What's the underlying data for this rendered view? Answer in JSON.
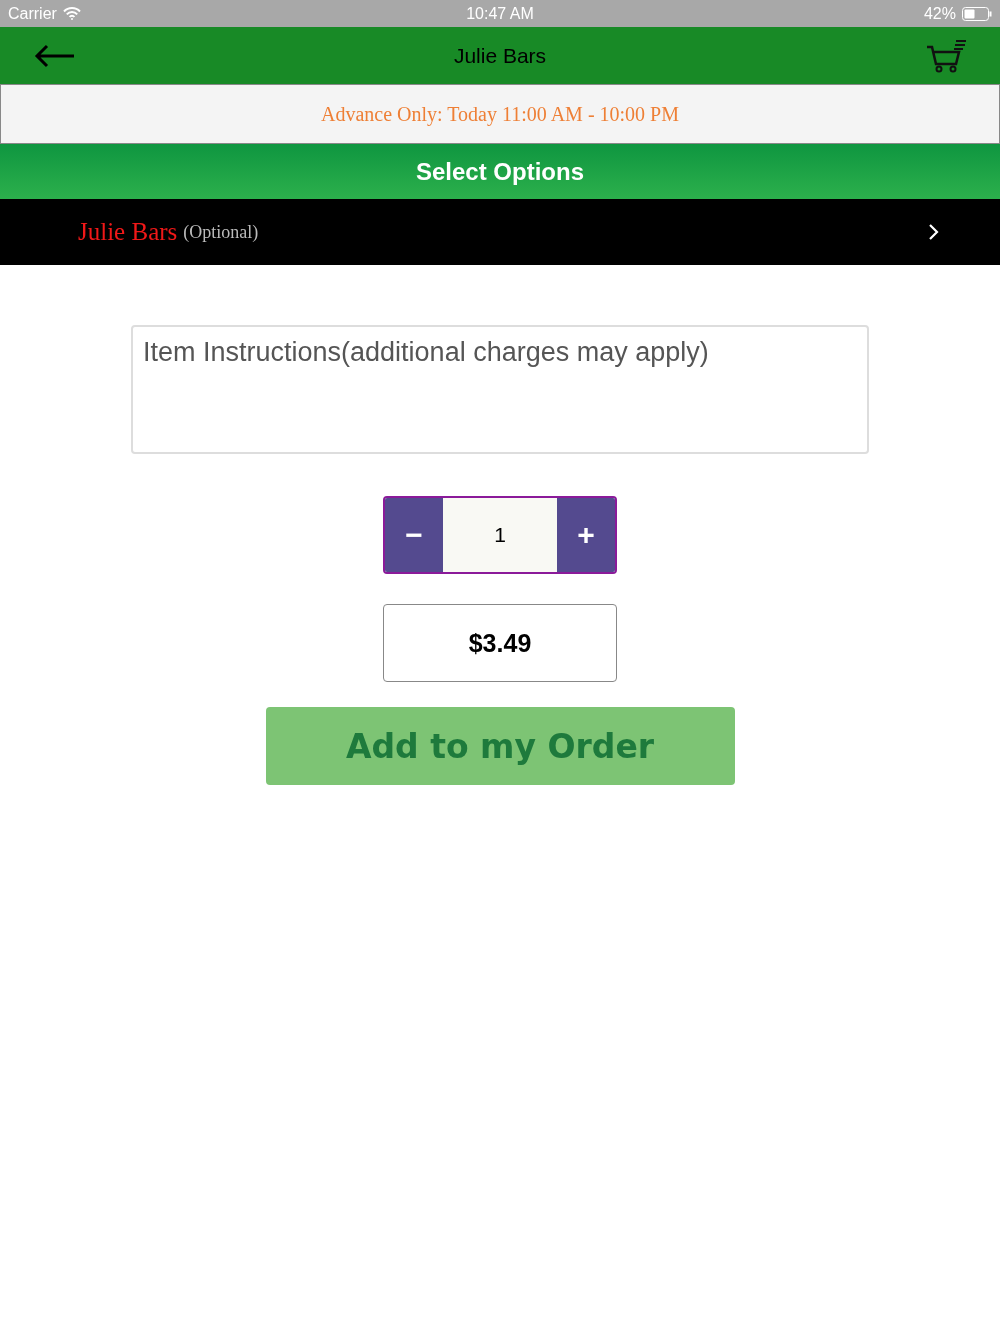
{
  "status_bar": {
    "carrier": "Carrier",
    "time": "10:47 AM",
    "battery": "42%"
  },
  "nav_bar": {
    "title": "Julie Bars"
  },
  "notice": "Advance Only: Today 11:00 AM - 10:00 PM",
  "section_header": "Select Options",
  "option_row": {
    "name": "Julie Bars",
    "note": "(Optional)"
  },
  "instructions": {
    "placeholder": "Item Instructions(additional charges may apply)"
  },
  "quantity": {
    "minus": "−",
    "value": "1",
    "plus": "+"
  },
  "price": "$3.49",
  "add_button": "Add to my Order"
}
